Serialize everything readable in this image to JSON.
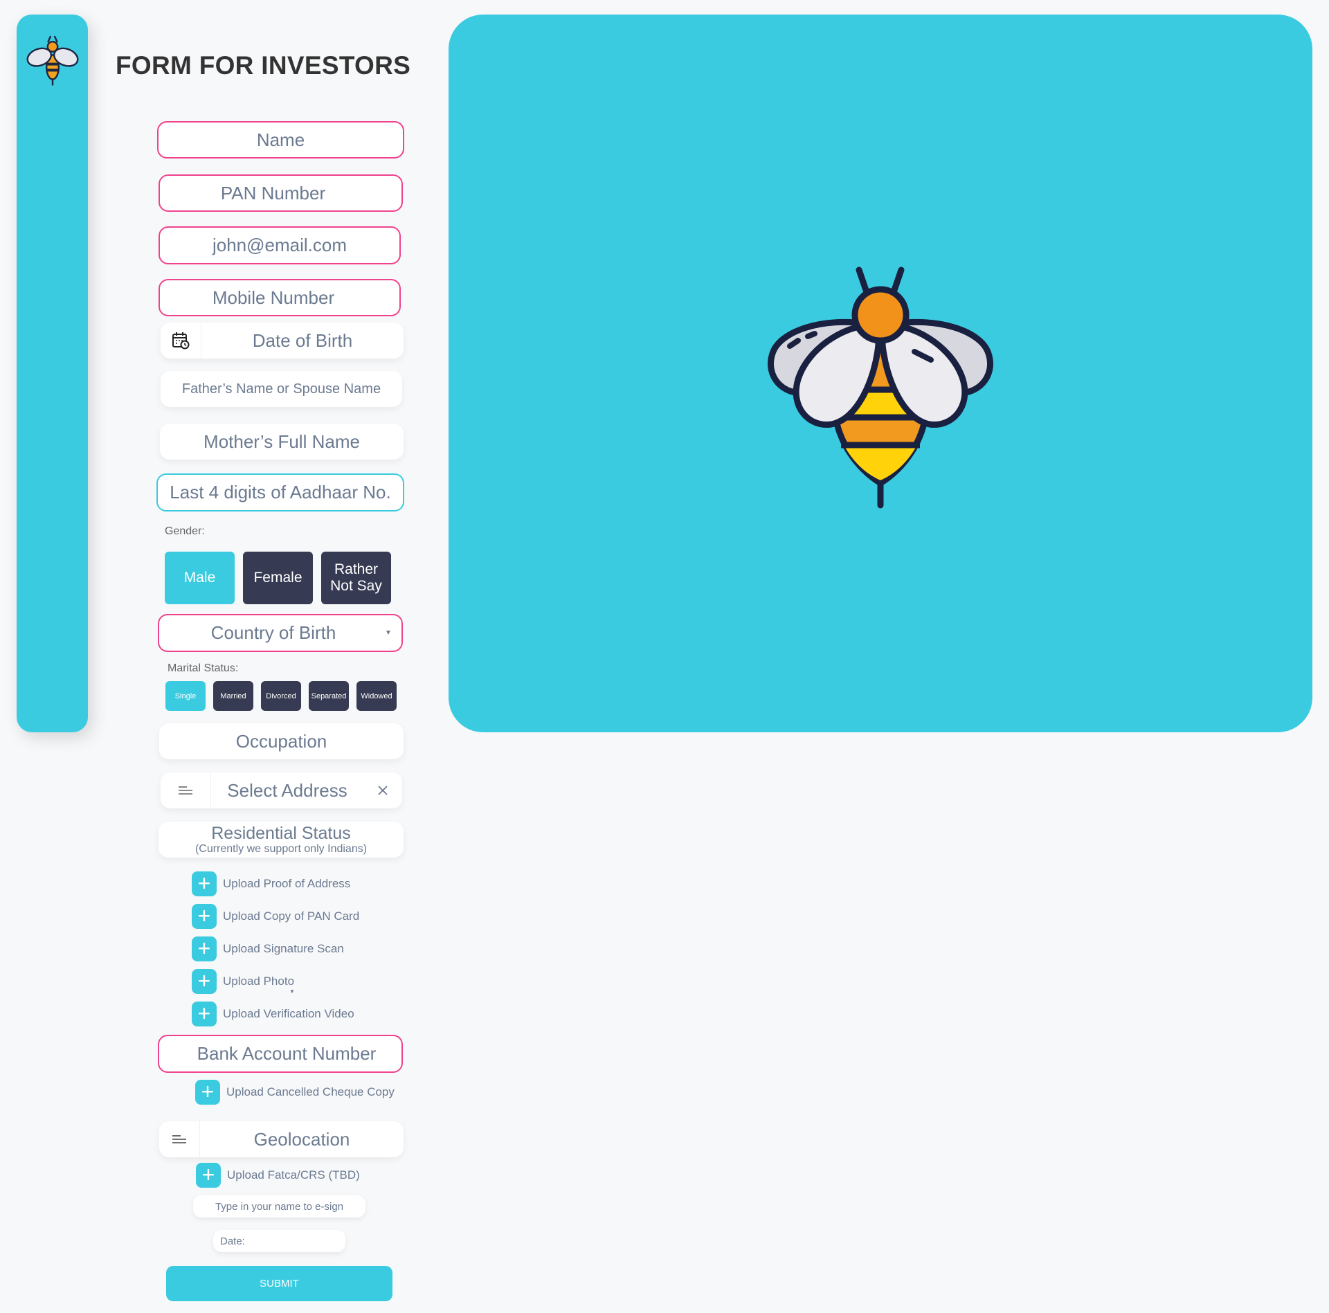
{
  "title": "FORM FOR INVESTORS",
  "fields": {
    "name": "Name",
    "pan": "PAN Number",
    "email": "john@email.com",
    "mobile": "Mobile Number",
    "dob": "Date of Birth",
    "father_spouse": "Father’s Name or Spouse Name",
    "mother": "Mother’s Full Name",
    "aadhaar": "Last 4 digits of Aadhaar No.",
    "country": "Country of Birth",
    "occupation": "Occupation",
    "address": "Select Address",
    "residential_status": "Residential Status",
    "residential_note": "(Currently we support only Indians)",
    "bank_account": "Bank Account Number",
    "geolocation": "Geolocation",
    "esign": "Type in your name to e-sign",
    "date": "Date:"
  },
  "gender": {
    "label": "Gender:",
    "options": [
      "Male",
      "Female",
      "Rather Not Say"
    ],
    "selected": "Male"
  },
  "marital": {
    "label": "Marital Status:",
    "options": [
      "Single",
      "Married",
      "Divorced",
      "Separated",
      "Widowed"
    ],
    "selected": "Single"
  },
  "uploads": {
    "proof_of_address": "Upload Proof of Address",
    "pan_card": "Upload Copy of PAN Card",
    "signature": "Upload Signature Scan",
    "photo": "Upload Photo",
    "video": "Upload Verification Video",
    "cheque": "Upload Cancelled Cheque Copy",
    "fatca": "Upload Fatca/CRS (TBD)"
  },
  "submit": "SUBMIT",
  "colors": {
    "accent": "#3bcbe0",
    "field_border": "#f0428d",
    "dark_button": "#363a52",
    "background": "#f7f8fa"
  },
  "icons": {
    "logo": "bee-icon",
    "dob": "calendar-icon",
    "address": "menu-lines-icon",
    "clear": "close-icon",
    "dropdown": "caret-down-icon",
    "upload": "plus-icon"
  }
}
